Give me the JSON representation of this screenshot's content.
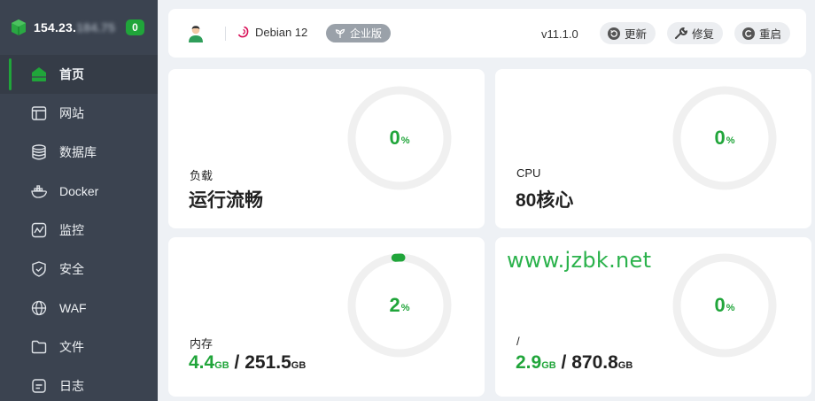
{
  "sidebar": {
    "ip_visible": "154.23.",
    "ip_blurred": "184.75",
    "badge": "0",
    "items": [
      {
        "label": "首页",
        "icon": "home-icon",
        "active": true
      },
      {
        "label": "网站",
        "icon": "website-icon"
      },
      {
        "label": "数据库",
        "icon": "database-icon"
      },
      {
        "label": "Docker",
        "icon": "docker-icon"
      },
      {
        "label": "监控",
        "icon": "monitor-icon"
      },
      {
        "label": "安全",
        "icon": "shield-icon"
      },
      {
        "label": "WAF",
        "icon": "waf-icon"
      },
      {
        "label": "文件",
        "icon": "folder-icon"
      },
      {
        "label": "日志",
        "icon": "log-icon"
      }
    ]
  },
  "topbar": {
    "os": "Debian 12",
    "edition": "企业版",
    "version": "v11.1.0",
    "update": "更新",
    "repair": "修复",
    "restart": "重启"
  },
  "cards": {
    "load": {
      "label": "负载",
      "status": "运行流畅",
      "percent": 0,
      "display": "0"
    },
    "cpu": {
      "label": "CPU",
      "cores": "80核心",
      "percent": 0,
      "display": "0"
    },
    "memory": {
      "label": "内存",
      "used": "4.4",
      "total": "251.5",
      "unit": "GB",
      "sep": "/",
      "percent": 2,
      "display": "2"
    },
    "disk": {
      "label": "/",
      "used": "2.9",
      "total": "870.8",
      "unit": "GB",
      "sep": "/",
      "percent": 0,
      "display": "0"
    }
  },
  "watermark": "www.jzbk.net",
  "colors": {
    "accent": "#20a53a",
    "sidebar": "#3b4350",
    "track": "#f0f0f0"
  }
}
